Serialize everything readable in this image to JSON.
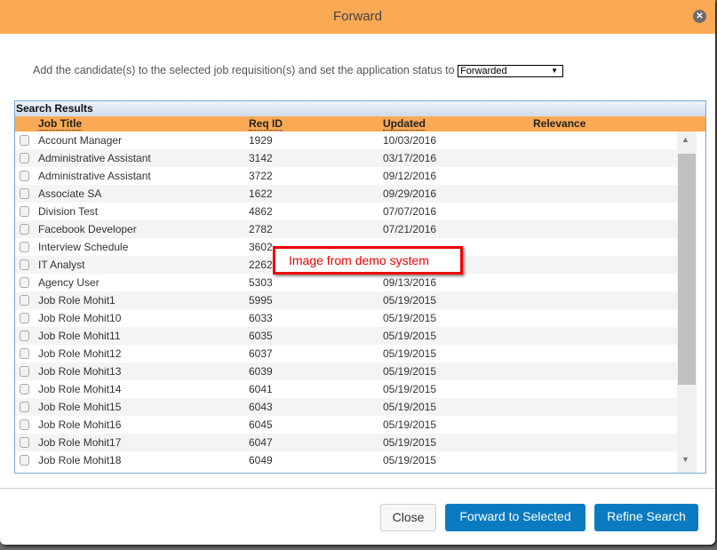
{
  "dialog": {
    "title": "Forward",
    "close_icon": "close-icon"
  },
  "prompt": {
    "text": "Add the candidate(s) to the selected job requisition(s) and set the application status to",
    "status_value": "Forwarded"
  },
  "table": {
    "caption": "Search Results",
    "headers": [
      "Job Title",
      "Req ID",
      "Updated",
      "Relevance"
    ],
    "rows": [
      [
        "Account Manager",
        "1929",
        "10/03/2016"
      ],
      [
        "Administrative Assistant",
        "3142",
        "03/17/2016"
      ],
      [
        "Administrative Assistant",
        "3722",
        "09/12/2016"
      ],
      [
        "Associate SA",
        "1622",
        "09/29/2016"
      ],
      [
        "Division Test",
        "4862",
        "07/07/2016"
      ],
      [
        "Facebook Developer",
        "2782",
        "07/21/2016"
      ],
      [
        "Interview Schedule",
        "3602",
        ""
      ],
      [
        "IT Analyst",
        "2262",
        ""
      ],
      [
        "Agency User",
        "5303",
        "09/13/2016"
      ],
      [
        "Job Role Mohit1",
        "5995",
        "05/19/2015"
      ],
      [
        "Job Role Mohit10",
        "6033",
        "05/19/2015"
      ],
      [
        "Job Role Mohit11",
        "6035",
        "05/19/2015"
      ],
      [
        "Job Role Mohit12",
        "6037",
        "05/19/2015"
      ],
      [
        "Job Role Mohit13",
        "6039",
        "05/19/2015"
      ],
      [
        "Job Role Mohit14",
        "6041",
        "05/19/2015"
      ],
      [
        "Job Role Mohit15",
        "6043",
        "05/19/2015"
      ],
      [
        "Job Role Mohit16",
        "6045",
        "05/19/2015"
      ],
      [
        "Job Role Mohit17",
        "6047",
        "05/19/2015"
      ],
      [
        "Job Role Mohit18",
        "6049",
        "05/19/2015"
      ]
    ]
  },
  "annotation": "Image from demo system",
  "buttons": {
    "close": "Close",
    "forward": "Forward to Selected",
    "refine": "Refine Search"
  },
  "colors": {
    "header": "#fba954",
    "primary": "#0a7bc1",
    "annotation": "#e00000"
  }
}
